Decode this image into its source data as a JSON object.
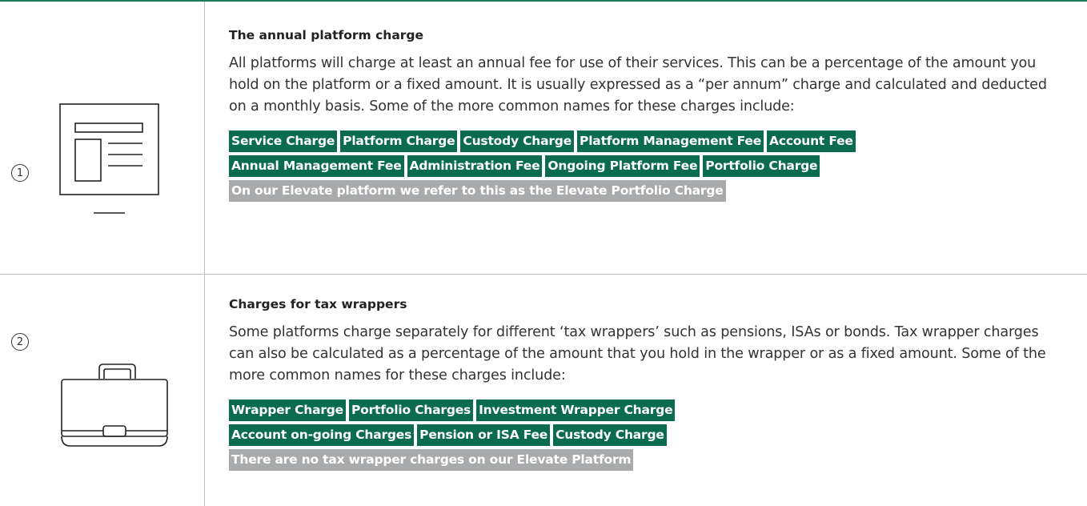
{
  "sections": [
    {
      "number": "1",
      "icon": "web-page-icon",
      "title": "The annual platform charge",
      "body": "All platforms will charge at least an annual fee for use of their services. This can be a percentage of the amount you hold on the platform or a fixed amount. It is usually expressed as a “per annum” charge and calculated and deducted on a monthly basis. Some of the more common names for these charges include:",
      "tag_rows": [
        [
          "Service Charge",
          "Platform Charge",
          "Custody Charge",
          "Platform Management Fee",
          "Account Fee"
        ],
        [
          "Annual Management Fee",
          "Administration Fee",
          "Ongoing Platform Fee",
          "Portfolio Charge"
        ]
      ],
      "note": "On our Elevate platform we refer to this as the Elevate Portfolio Charge"
    },
    {
      "number": "2",
      "icon": "briefcase-icon",
      "title": "Charges for tax wrappers",
      "body": "Some platforms charge separately for different ‘tax wrappers’ such as pensions, ISAs or bonds. Tax wrapper charges can also be calculated as a percentage of the amount that you hold in the wrapper or as a fixed amount. Some of the more common names for these charges include:",
      "tag_rows": [
        [
          "Wrapper Charge",
          "Portfolio Charges",
          "Investment Wrapper Charge"
        ],
        [
          "Account on-going Charges",
          "Pension or ISA Fee",
          "Custody Charge"
        ]
      ],
      "note": "There are no tax wrapper charges on our Elevate Platform"
    }
  ],
  "colors": {
    "accent": "#0a6b4f",
    "note": "#a9aaab",
    "rule": "#1f7a5c"
  }
}
